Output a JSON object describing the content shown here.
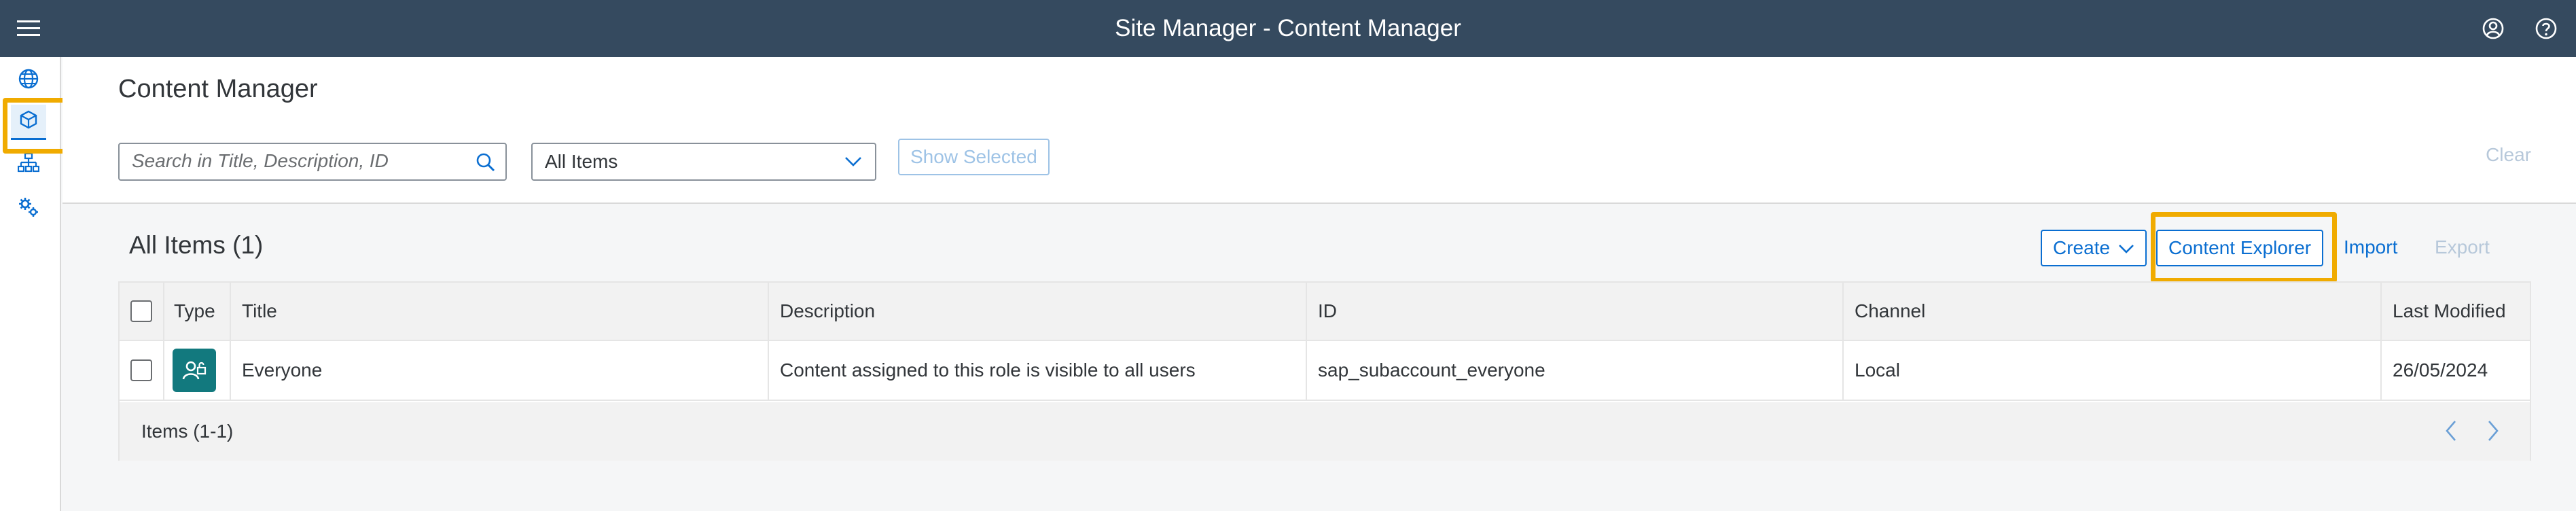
{
  "shell": {
    "title": "Site Manager - Content Manager",
    "icons": [
      "menu-icon",
      "user-icon",
      "help-icon"
    ]
  },
  "leftnav": {
    "items": [
      {
        "name": "sites",
        "icon": "globe-icon",
        "selected": false
      },
      {
        "name": "content-manager",
        "icon": "cube-icon",
        "selected": true
      },
      {
        "name": "hierarchy",
        "icon": "org-chart-icon",
        "selected": false
      },
      {
        "name": "settings",
        "icon": "gears-icon",
        "selected": false
      }
    ]
  },
  "header": {
    "page_title": "Content Manager",
    "search_placeholder": "Search in Title, Description, ID",
    "filter_value": "All Items",
    "show_selected": "Show Selected",
    "clear": "Clear"
  },
  "panel": {
    "title": "All Items (1)",
    "create": "Create",
    "content_explorer": "Content Explorer",
    "import": "Import",
    "export": "Export"
  },
  "table": {
    "columns": [
      "Type",
      "Title",
      "Description",
      "ID",
      "Channel",
      "Last Modified"
    ],
    "rows": [
      {
        "type_icon": "role-icon",
        "title": "Everyone",
        "description": "Content assigned to this role is visible to all users",
        "id": "sap_subaccount_everyone",
        "channel": "Local",
        "last_modified": "26/05/2024"
      }
    ],
    "footer": "Items (1-1)"
  },
  "colors": {
    "shell": "#354a5f",
    "accent": "#0a6ed1",
    "highlight": "#f0ab00",
    "type_tile": "#12797e"
  }
}
